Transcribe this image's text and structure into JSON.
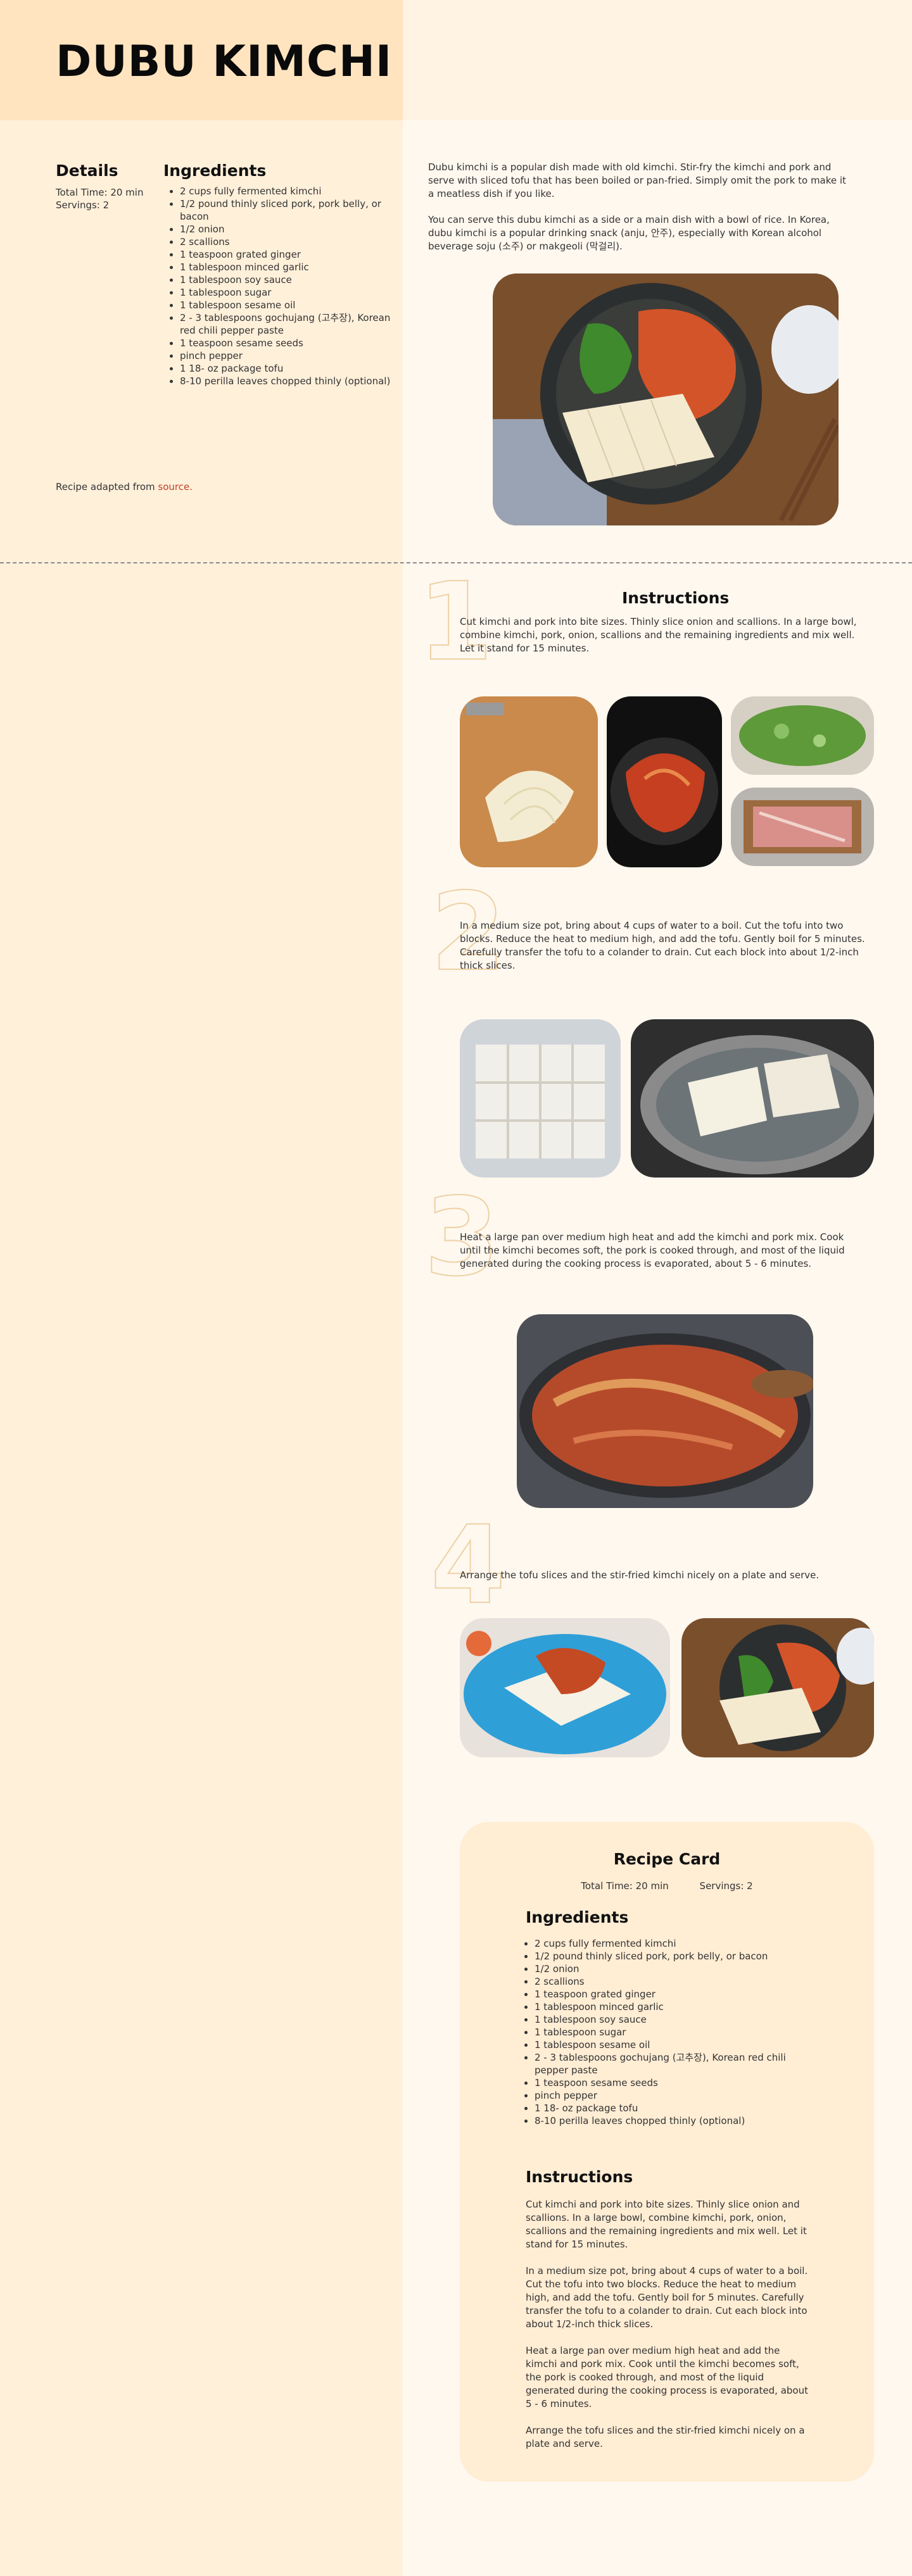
{
  "page": {
    "title": "DUBU KIMCHI"
  },
  "details": {
    "heading": "Details",
    "total_time": "Total Time: 20 min",
    "servings": "Servings: 2"
  },
  "ingredients": {
    "heading": "Ingredients",
    "items": [
      "2 cups fully fermented kimchi",
      "1/2 pound thinly sliced pork, pork belly, or bacon",
      "1/2 onion",
      "2 scallions",
      "1 teaspoon grated ginger",
      "1 tablespoon minced garlic",
      "1 tablespoon soy sauce",
      "1 tablespoon sugar",
      "1 tablespoon sesame oil",
      "2 - 3 tablespoons gochujang (고추장), Korean red chili pepper paste",
      "1 teaspoon sesame seeds",
      "pinch pepper",
      "1 18- oz package tofu",
      "8-10 perilla leaves chopped thinly (optional)"
    ]
  },
  "adapted": {
    "prefix": "Recipe adapted from ",
    "link": "source."
  },
  "intro": {
    "p1": "Dubu kimchi is a popular dish made with old kimchi. Stir-fry the kimchi and pork and serve with sliced tofu that has been boiled or pan-fried. Simply omit the pork to make it a meatless dish if you like.",
    "p2": "You can serve this dubu kimchi as a side or a main dish with a bowl of rice. In Korea, dubu kimchi is a popular drinking snack (anju, 안주), especially with Korean alcohol beverage soju (소주) or makgeoli (막걸리)."
  },
  "instructions": {
    "heading": "Instructions",
    "steps": [
      {
        "num": "1",
        "text": "Cut kimchi and pork into bite sizes. Thinly slice onion and scallions. In a large bowl, combine kimchi, pork, onion, scallions and the remaining ingredients and mix well. Let it stand for 15 minutes."
      },
      {
        "num": "2",
        "text": "In a medium size pot, bring about 4 cups of water to a boil. Cut the tofu into two blocks. Reduce the heat to medium high, and add the tofu. Gently boil for 5 minutes. Carefully transfer the tofu to a colander to drain. Cut each block into about 1/2-inch thick slices."
      },
      {
        "num": "3",
        "text": "Heat a large pan over medium high heat and add the kimchi and pork mix. Cook until the kimchi becomes soft, the pork is cooked through, and most of the liquid generated during the cooking process is evaporated, about 5 - 6 minutes."
      },
      {
        "num": "4",
        "text": "Arrange the tofu slices and the stir-fried kimchi nicely on a plate and serve."
      }
    ]
  },
  "recipe_card": {
    "title": "Recipe Card",
    "total_time": "Total Time: 20 min",
    "servings": "Servings: 2",
    "ingredients_heading": "Ingredients",
    "ingredients": [
      "2 cups fully fermented kimchi",
      "1/2 pound thinly sliced pork, pork belly, or bacon",
      "1/2 onion",
      "2 scallions",
      "1 teaspoon grated ginger",
      "1 tablespoon minced garlic",
      "1 tablespoon soy sauce",
      "1 tablespoon sugar",
      "1 tablespoon sesame oil",
      "2 - 3 tablespoons gochujang (고추장), Korean red chili pepper paste",
      "1 teaspoon sesame seeds",
      "pinch pepper",
      "1 18- oz package tofu",
      "8-10 perilla leaves chopped thinly (optional)"
    ],
    "instructions_heading": "Instructions",
    "instructions": [
      "Cut kimchi and pork into bite sizes. Thinly slice onion and scallions. In a large bowl, combine kimchi, pork, onion, scallions and the remaining ingredients and mix well. Let it stand for 15 minutes.",
      "In a medium size pot, bring about 4 cups of water to a boil. Cut the tofu into two blocks. Reduce the heat to medium high, and add the tofu. Gently boil for 5 minutes. Carefully transfer the tofu to a colander to drain. Cut each block into about 1/2-inch thick slices.",
      "Heat a large pan over medium high heat and add the kimchi and pork mix. Cook until the kimchi becomes soft, the pork is cooked through, and most of the liquid generated during the cooking process is evaporated, about 5 - 6 minutes.",
      "Arrange the tofu slices and the stir-fried kimchi nicely on a plate and serve."
    ]
  },
  "colors": {
    "left_bg": "#fff0da",
    "title_bg": "#ffe4bf",
    "right_bg": "#fff8ef",
    "card_bg": "#ffedd4",
    "link": "#c2402a",
    "step_outline": "#edd1a4"
  }
}
